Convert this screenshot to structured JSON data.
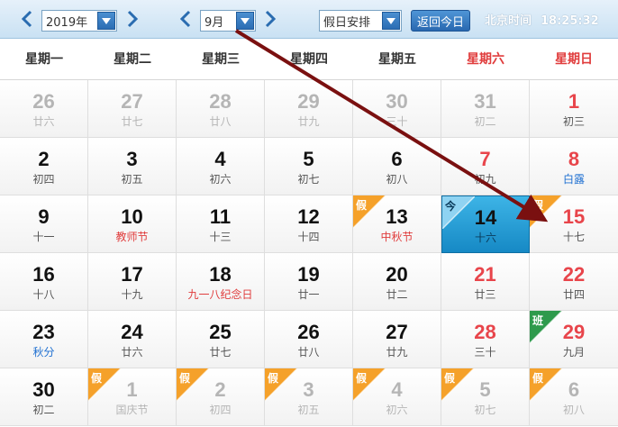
{
  "toolbar": {
    "year": "2019年",
    "month": "9月",
    "holiday": "假日安排",
    "today_label": "返回今日",
    "clock_label": "北京时间",
    "clock_time": "18:25:32"
  },
  "weekdays": [
    "星期一",
    "星期二",
    "星期三",
    "星期四",
    "星期五",
    "星期六",
    "星期日"
  ],
  "badges": {
    "holiday": "假",
    "work": "班",
    "today": "今"
  },
  "colors": {
    "weekend": "#e8454b",
    "holiday_badge": "#f5a12a",
    "work_badge": "#2e9a4c",
    "today_bg": "#1e9bd6",
    "arrow": "#7a1010"
  },
  "weeks": [
    [
      {
        "day": "26",
        "lunar": "廿六",
        "other": true
      },
      {
        "day": "27",
        "lunar": "廿七",
        "other": true
      },
      {
        "day": "28",
        "lunar": "廿八",
        "other": true
      },
      {
        "day": "29",
        "lunar": "廿九",
        "other": true
      },
      {
        "day": "30",
        "lunar": "三十",
        "other": true
      },
      {
        "day": "31",
        "lunar": "初二",
        "other": true
      },
      {
        "day": "1",
        "lunar": "初三"
      }
    ],
    [
      {
        "day": "2",
        "lunar": "初四"
      },
      {
        "day": "3",
        "lunar": "初五"
      },
      {
        "day": "4",
        "lunar": "初六"
      },
      {
        "day": "5",
        "lunar": "初七"
      },
      {
        "day": "6",
        "lunar": "初八"
      },
      {
        "day": "7",
        "lunar": "初九"
      },
      {
        "day": "8",
        "lunar": "白露",
        "festival": "blue"
      }
    ],
    [
      {
        "day": "9",
        "lunar": "十一"
      },
      {
        "day": "10",
        "lunar": "教师节",
        "festival": "red"
      },
      {
        "day": "11",
        "lunar": "十三"
      },
      {
        "day": "12",
        "lunar": "十四"
      },
      {
        "day": "13",
        "lunar": "中秋节",
        "festival": "red",
        "badge": "holiday"
      },
      {
        "day": "14",
        "lunar": "十六",
        "today": true,
        "badge": "today"
      },
      {
        "day": "15",
        "lunar": "十七",
        "badge": "holiday"
      }
    ],
    [
      {
        "day": "16",
        "lunar": "十八"
      },
      {
        "day": "17",
        "lunar": "十九"
      },
      {
        "day": "18",
        "lunar": "九一八纪念日",
        "festival": "red"
      },
      {
        "day": "19",
        "lunar": "廿一"
      },
      {
        "day": "20",
        "lunar": "廿二"
      },
      {
        "day": "21",
        "lunar": "廿三"
      },
      {
        "day": "22",
        "lunar": "廿四"
      }
    ],
    [
      {
        "day": "23",
        "lunar": "秋分",
        "festival": "blue"
      },
      {
        "day": "24",
        "lunar": "廿六"
      },
      {
        "day": "25",
        "lunar": "廿七"
      },
      {
        "day": "26",
        "lunar": "廿八"
      },
      {
        "day": "27",
        "lunar": "廿九"
      },
      {
        "day": "28",
        "lunar": "三十"
      },
      {
        "day": "29",
        "lunar": "九月",
        "badge": "work"
      }
    ],
    [
      {
        "day": "30",
        "lunar": "初二"
      },
      {
        "day": "1",
        "lunar": "国庆节",
        "other": true,
        "badge": "holiday"
      },
      {
        "day": "2",
        "lunar": "初四",
        "other": true,
        "badge": "holiday"
      },
      {
        "day": "3",
        "lunar": "初五",
        "other": true,
        "badge": "holiday"
      },
      {
        "day": "4",
        "lunar": "初六",
        "other": true,
        "badge": "holiday"
      },
      {
        "day": "5",
        "lunar": "初七",
        "other": true,
        "badge": "holiday"
      },
      {
        "day": "6",
        "lunar": "初八",
        "other": true,
        "badge": "holiday"
      }
    ]
  ]
}
